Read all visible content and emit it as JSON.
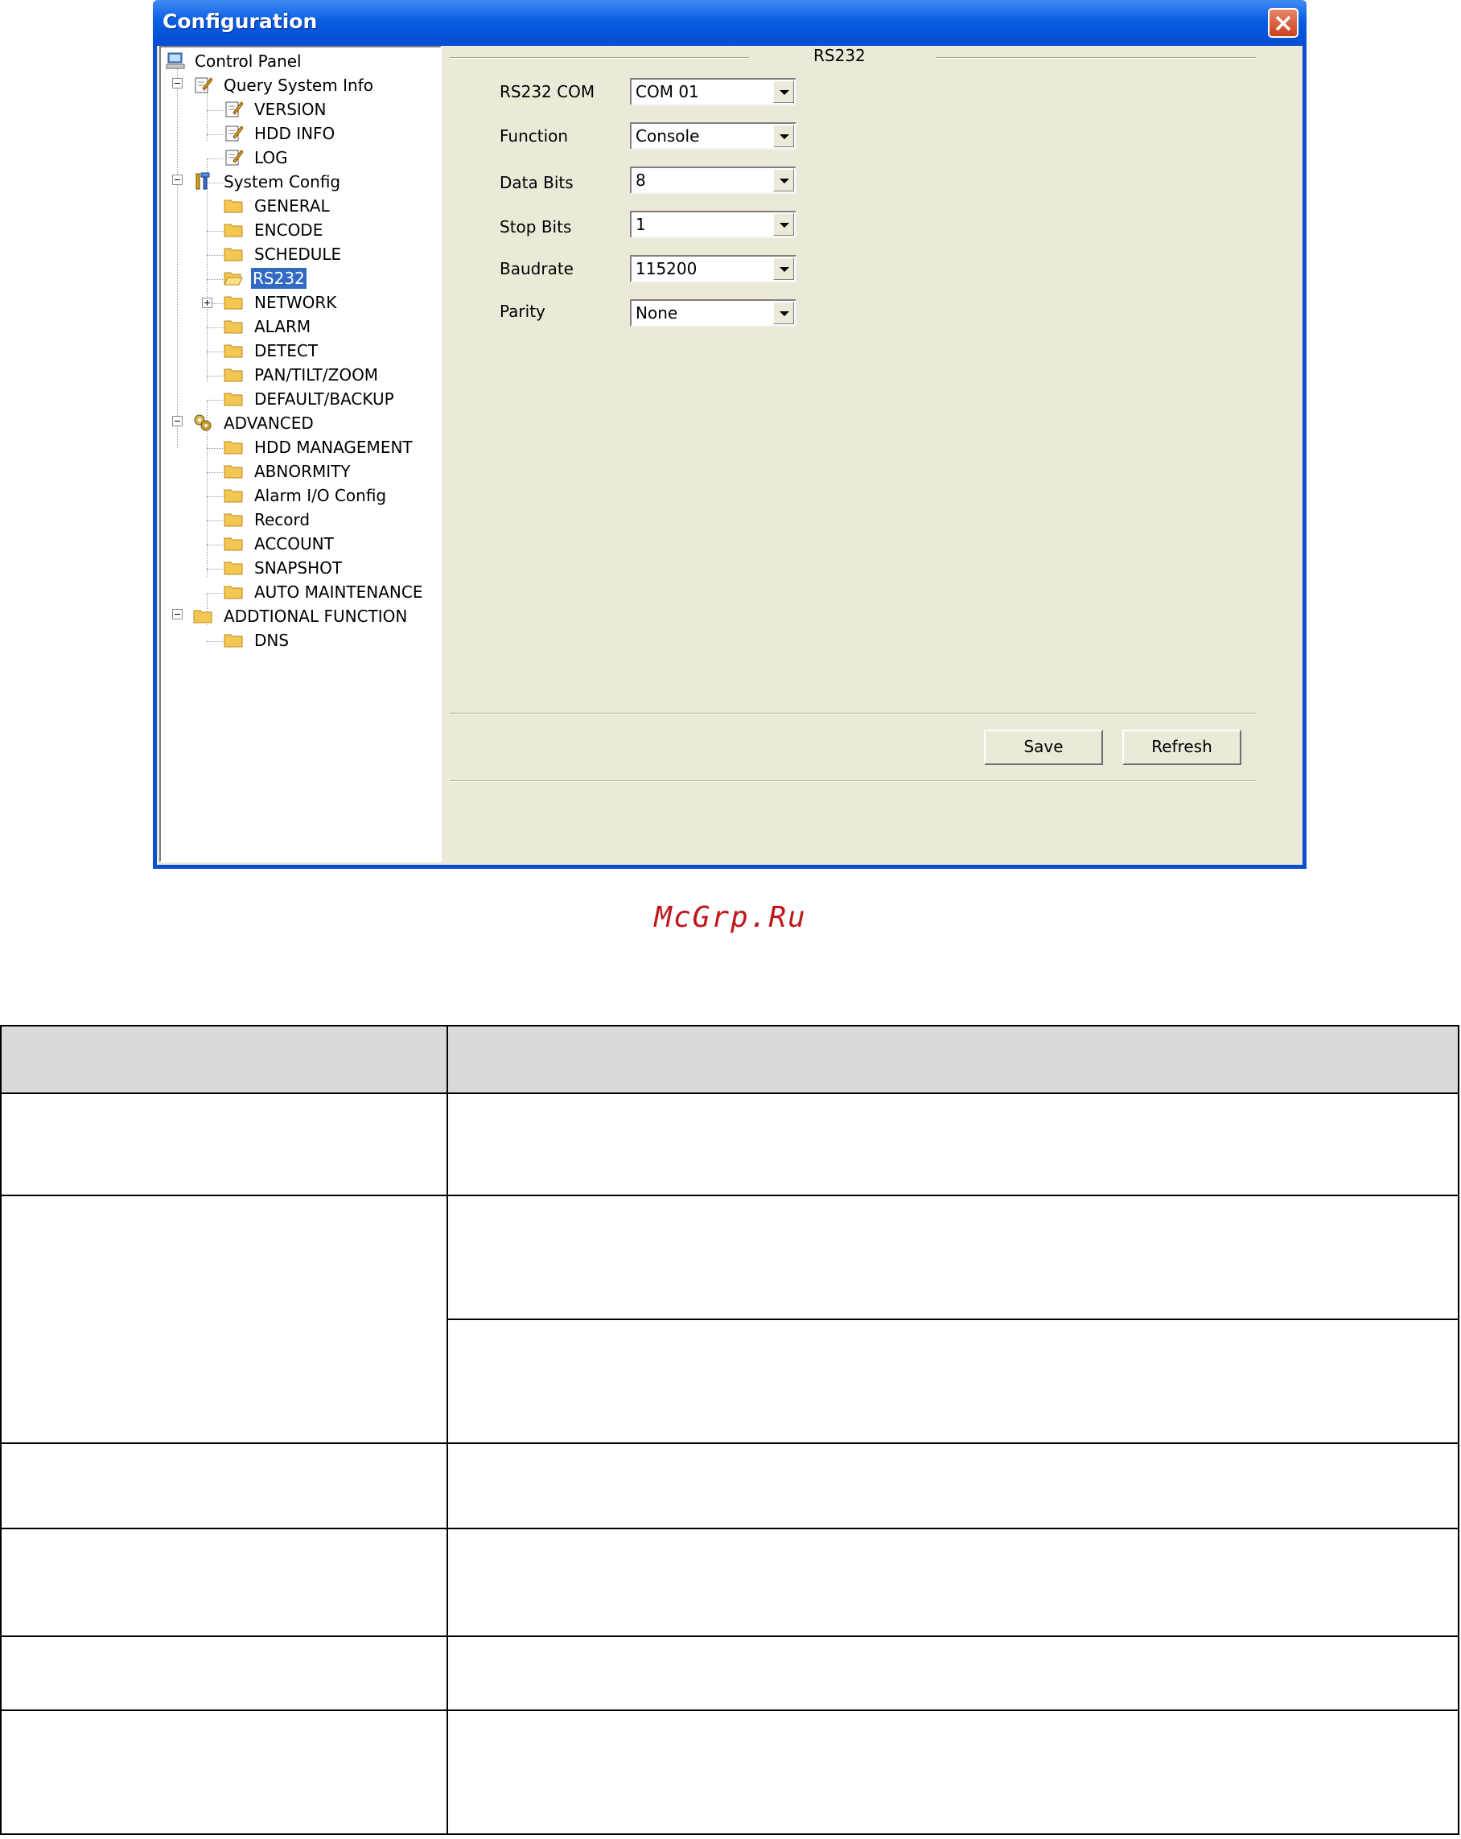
{
  "window": {
    "title": "Configuration"
  },
  "tree": [
    {
      "label": "Control Panel"
    },
    {
      "label": "Query System Info"
    },
    {
      "label": "VERSION"
    },
    {
      "label": "HDD INFO"
    },
    {
      "label": "LOG"
    },
    {
      "label": "System Config"
    },
    {
      "label": "GENERAL"
    },
    {
      "label": "ENCODE"
    },
    {
      "label": "SCHEDULE"
    },
    {
      "label": "RS232"
    },
    {
      "label": "NETWORK"
    },
    {
      "label": "ALARM"
    },
    {
      "label": "DETECT"
    },
    {
      "label": "PAN/TILT/ZOOM"
    },
    {
      "label": "DEFAULT/BACKUP"
    },
    {
      "label": "ADVANCED"
    },
    {
      "label": "HDD MANAGEMENT"
    },
    {
      "label": "ABNORMITY"
    },
    {
      "label": "Alarm I/O Config"
    },
    {
      "label": "Record"
    },
    {
      "label": "ACCOUNT"
    },
    {
      "label": "SNAPSHOT"
    },
    {
      "label": "AUTO MAINTENANCE"
    },
    {
      "label": "ADDTIONAL FUNCTION"
    },
    {
      "label": "DNS"
    }
  ],
  "panel": {
    "group_title": "RS232",
    "fields": [
      {
        "label": "RS232 COM",
        "value": "COM 01"
      },
      {
        "label": "Function",
        "value": "Console"
      },
      {
        "label": "Data Bits",
        "value": "8"
      },
      {
        "label": "Stop Bits",
        "value": "1"
      },
      {
        "label": "Baudrate",
        "value": "115200"
      },
      {
        "label": "Parity",
        "value": "None"
      }
    ],
    "save_label": "Save",
    "refresh_label": "Refresh"
  },
  "watermark": "McGrp.Ru"
}
